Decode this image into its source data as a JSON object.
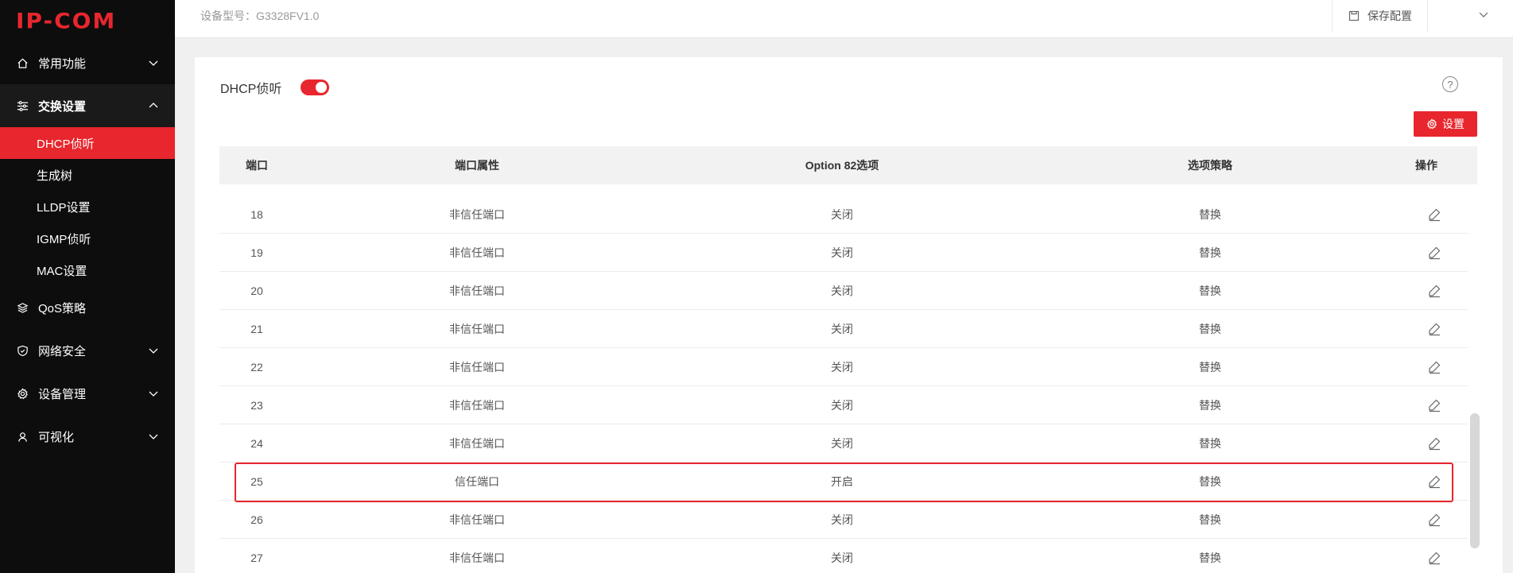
{
  "brand": {
    "logo": "IP-COM",
    "accent": "#e8262d"
  },
  "sidebar": {
    "groups": [
      {
        "label": "常用功能",
        "icon": "home-icon",
        "open": false
      },
      {
        "label": "交换设置",
        "icon": "sliders-icon",
        "open": true,
        "items": [
          "DHCP侦听",
          "生成树",
          "LLDP设置",
          "IGMP侦听",
          "MAC设置"
        ],
        "active": "DHCP侦听"
      },
      {
        "label": "QoS策略",
        "icon": "layers-icon",
        "open": false
      },
      {
        "label": "网络安全",
        "icon": "shield-icon",
        "open": false
      },
      {
        "label": "设备管理",
        "icon": "gear-icon",
        "open": false
      },
      {
        "label": "可视化",
        "icon": "location-icon",
        "open": false
      }
    ]
  },
  "header": {
    "model": "设备型号：G3328FV1.0",
    "save_label": "保存配置"
  },
  "main": {
    "toggle_label": "DHCP侦听",
    "toggle_on": true,
    "help": "?",
    "set_button": "设置",
    "columns": [
      "端口",
      "端口属性",
      "Option 82选项",
      "选项策略",
      "操作"
    ],
    "rows": [
      {
        "port": "18",
        "attr": "非信任端口",
        "option82": "关闭",
        "policy": "替换"
      },
      {
        "port": "19",
        "attr": "非信任端口",
        "option82": "关闭",
        "policy": "替换"
      },
      {
        "port": "20",
        "attr": "非信任端口",
        "option82": "关闭",
        "policy": "替换"
      },
      {
        "port": "21",
        "attr": "非信任端口",
        "option82": "关闭",
        "policy": "替换"
      },
      {
        "port": "22",
        "attr": "非信任端口",
        "option82": "关闭",
        "policy": "替换"
      },
      {
        "port": "23",
        "attr": "非信任端口",
        "option82": "关闭",
        "policy": "替换"
      },
      {
        "port": "24",
        "attr": "非信任端口",
        "option82": "关闭",
        "policy": "替换"
      },
      {
        "port": "25",
        "attr": "信任端口",
        "option82": "开启",
        "policy": "替换"
      },
      {
        "port": "26",
        "attr": "非信任端口",
        "option82": "关闭",
        "policy": "替换"
      },
      {
        "port": "27",
        "attr": "非信任端口",
        "option82": "关闭",
        "policy": "替换"
      }
    ],
    "highlighted_port": "25"
  }
}
